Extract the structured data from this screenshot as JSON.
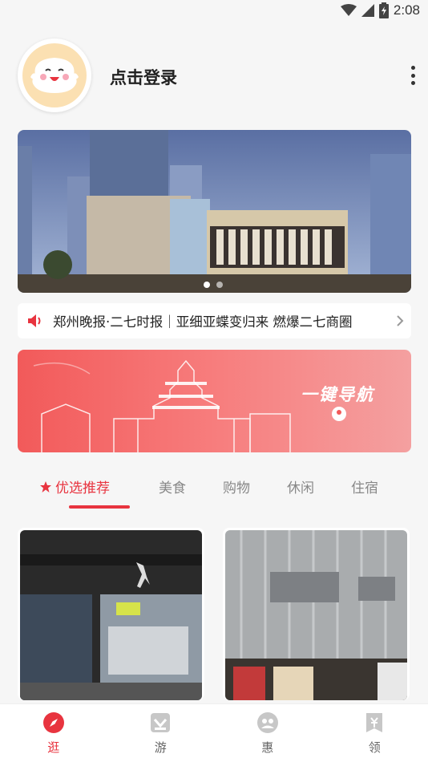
{
  "status_bar": {
    "time": "2:08"
  },
  "header": {
    "login_label": "点击登录"
  },
  "banner": {
    "slide_count": 2,
    "active_slide": 1
  },
  "news": {
    "text": "郑州晚报·二七时报｜亚细亚蝶变归来 燃爆二七商圈"
  },
  "nav_card": {
    "label": "一键导航"
  },
  "tabs": [
    {
      "label": "优选推荐",
      "active": true
    },
    {
      "label": "美食",
      "active": false
    },
    {
      "label": "购物",
      "active": false
    },
    {
      "label": "休闲",
      "active": false
    },
    {
      "label": "住宿",
      "active": false
    }
  ],
  "bottom_nav": [
    {
      "label": "逛",
      "icon": "compass-icon",
      "active": true
    },
    {
      "label": "游",
      "icon": "scenic-icon",
      "active": false
    },
    {
      "label": "惠",
      "icon": "discount-icon",
      "active": false
    },
    {
      "label": "领",
      "icon": "coupon-icon",
      "active": false
    }
  ],
  "colors": {
    "accent": "#e8343f",
    "nav_card": "#f25a5a"
  }
}
